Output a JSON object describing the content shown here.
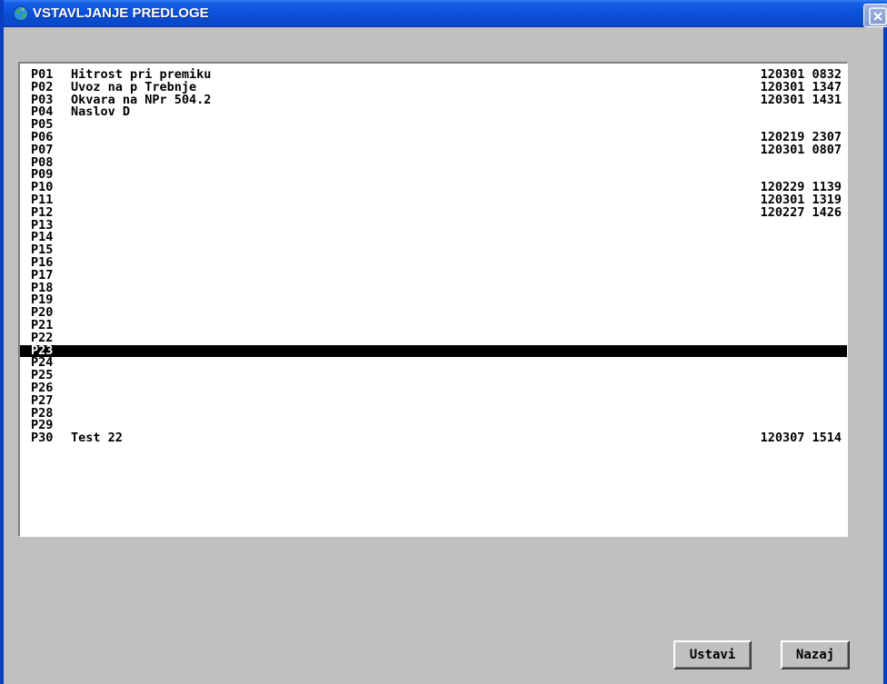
{
  "window": {
    "title": "VSTAVLJANJE PREDLOGE",
    "title_icon": "globe-icon",
    "close_icon": "close-icon",
    "colors": {
      "titlebar": "#0b4fd6",
      "background": "#c0c0c0",
      "list_background": "#ffffff",
      "selection": "#000000"
    }
  },
  "templates": [
    {
      "code": "P01",
      "name": "Hitrost pri premiku",
      "stamp": "120301 0832"
    },
    {
      "code": "P02",
      "name": "Uvoz na p Trebnje",
      "stamp": "120301 1347"
    },
    {
      "code": "P03",
      "name": "Okvara na NPr 504.2",
      "stamp": "120301 1431"
    },
    {
      "code": "P04",
      "name": "Naslov D",
      "stamp": ""
    },
    {
      "code": "P05",
      "name": "",
      "stamp": ""
    },
    {
      "code": "P06",
      "name": "",
      "stamp": "120219 2307"
    },
    {
      "code": "P07",
      "name": "",
      "stamp": "120301 0807"
    },
    {
      "code": "P08",
      "name": "",
      "stamp": ""
    },
    {
      "code": "P09",
      "name": "",
      "stamp": ""
    },
    {
      "code": "P10",
      "name": "",
      "stamp": "120229 1139"
    },
    {
      "code": "P11",
      "name": "",
      "stamp": "120301 1319"
    },
    {
      "code": "P12",
      "name": "",
      "stamp": "120227 1426"
    },
    {
      "code": "P13",
      "name": "",
      "stamp": ""
    },
    {
      "code": "P14",
      "name": "",
      "stamp": ""
    },
    {
      "code": "P15",
      "name": "",
      "stamp": ""
    },
    {
      "code": "P16",
      "name": "",
      "stamp": ""
    },
    {
      "code": "P17",
      "name": "",
      "stamp": ""
    },
    {
      "code": "P18",
      "name": "",
      "stamp": ""
    },
    {
      "code": "P19",
      "name": "",
      "stamp": ""
    },
    {
      "code": "P20",
      "name": "",
      "stamp": ""
    },
    {
      "code": "P21",
      "name": "",
      "stamp": ""
    },
    {
      "code": "P22",
      "name": "",
      "stamp": ""
    },
    {
      "code": "P23",
      "name": "",
      "stamp": "",
      "selected": true
    },
    {
      "code": "P24",
      "name": "",
      "stamp": ""
    },
    {
      "code": "P25",
      "name": "",
      "stamp": ""
    },
    {
      "code": "P26",
      "name": "",
      "stamp": ""
    },
    {
      "code": "P27",
      "name": "",
      "stamp": ""
    },
    {
      "code": "P28",
      "name": "",
      "stamp": ""
    },
    {
      "code": "P29",
      "name": "",
      "stamp": ""
    },
    {
      "code": "P30",
      "name": "Test 22",
      "stamp": "120307 1514"
    }
  ],
  "buttons": {
    "insert_label": "Ustavi",
    "back_label": "Nazaj"
  }
}
